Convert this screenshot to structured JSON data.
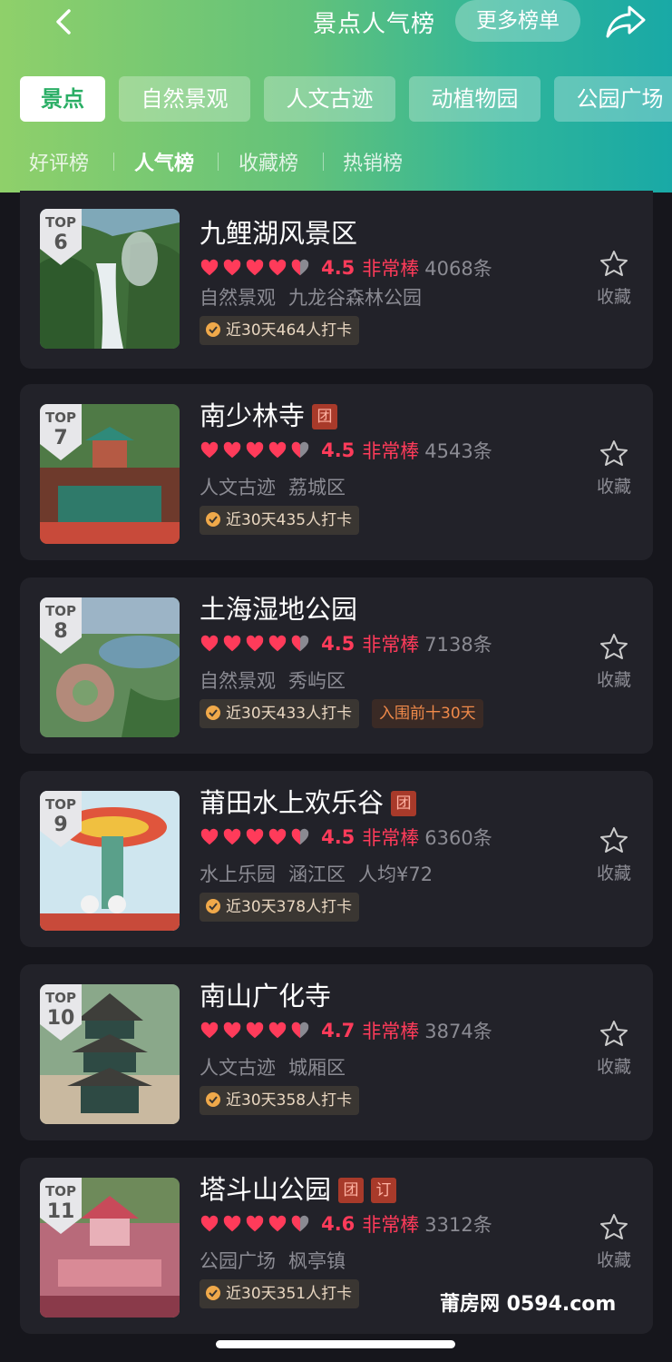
{
  "header": {
    "title": "景点人气榜",
    "more_button": "更多榜单",
    "categories": [
      "景点",
      "自然景观",
      "人文古迹",
      "动植物园",
      "公园广场"
    ],
    "subtabs": [
      "好评榜",
      "人气榜",
      "收藏榜",
      "热销榜"
    ]
  },
  "colors": {
    "accent_green": "#2aae65",
    "rating_red": "#ff3b5a",
    "card_bg": "#222229"
  },
  "items": [
    {
      "top_label": "TOP",
      "rank": "6",
      "name": "九鲤湖风景区",
      "tags": [],
      "score": "4.5",
      "level": "非常棒",
      "count": "4068条",
      "sub1": "自然景观",
      "sub2": "九龙谷森林公园",
      "sub3": "",
      "checkin": "近30天464人打卡",
      "extra": "",
      "fav": "收藏"
    },
    {
      "top_label": "TOP",
      "rank": "7",
      "name": "南少林寺",
      "tags": [
        "团"
      ],
      "score": "4.5",
      "level": "非常棒",
      "count": "4543条",
      "sub1": "人文古迹",
      "sub2": "荔城区",
      "sub3": "",
      "checkin": "近30天435人打卡",
      "extra": "",
      "fav": "收藏"
    },
    {
      "top_label": "TOP",
      "rank": "8",
      "name": "土海湿地公园",
      "tags": [],
      "score": "4.5",
      "level": "非常棒",
      "count": "7138条",
      "sub1": "自然景观",
      "sub2": "秀屿区",
      "sub3": "",
      "checkin": "近30天433人打卡",
      "extra": "入围前十30天",
      "fav": "收藏"
    },
    {
      "top_label": "TOP",
      "rank": "9",
      "name": "莆田水上欢乐谷",
      "tags": [
        "团"
      ],
      "score": "4.5",
      "level": "非常棒",
      "count": "6360条",
      "sub1": "水上乐园",
      "sub2": "涵江区",
      "sub3": "人均¥72",
      "checkin": "近30天378人打卡",
      "extra": "",
      "fav": "收藏"
    },
    {
      "top_label": "TOP",
      "rank": "10",
      "name": "南山广化寺",
      "tags": [],
      "score": "4.7",
      "level": "非常棒",
      "count": "3874条",
      "sub1": "人文古迹",
      "sub2": "城厢区",
      "sub3": "",
      "checkin": "近30天358人打卡",
      "extra": "",
      "fav": "收藏"
    },
    {
      "top_label": "TOP",
      "rank": "11",
      "name": "塔斗山公园",
      "tags": [
        "团",
        "订"
      ],
      "score": "4.6",
      "level": "非常棒",
      "count": "3312条",
      "sub1": "公园广场",
      "sub2": "枫亭镇",
      "sub3": "",
      "checkin": "近30天351人打卡",
      "extra": "",
      "fav": "收藏"
    }
  ],
  "watermark": "莆房网 0594.com"
}
